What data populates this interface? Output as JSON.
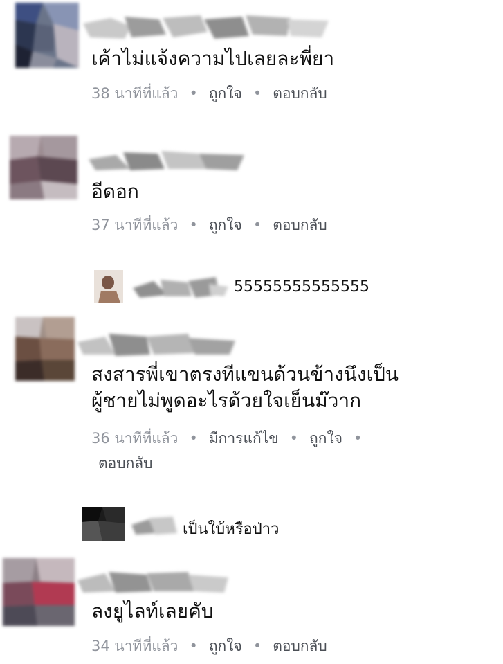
{
  "comments": [
    {
      "text": "เค้าไม่แจ้งความไปเลยละพี่ยา",
      "time": "38 นาทีที่แล้ว",
      "like": "ถูกใจ",
      "reply": "ตอบกลับ"
    },
    {
      "text": "อีดอก",
      "time": "37 นาทีที่แล้ว",
      "like": "ถูกใจ",
      "reply": "ตอบกลับ"
    },
    {
      "text_line1": "สงสารพี่เขาตรงทีแขนด้วนข้างนึงเป็น",
      "text_line2": "ผู้ชายไม่พูดอะไรด้วยใจเย็นม๊วาก",
      "time": "36 นาทีที่แล้ว",
      "edited": "มีการแก้ไข",
      "like": "ถูกใจ",
      "reply": "ตอบกลับ"
    },
    {
      "text": "ลงยูไลท์เลยคับ",
      "time": "34 นาทีที่แล้ว",
      "like": "ถูกใจ",
      "reply": "ตอบกลับ"
    }
  ],
  "replies": [
    {
      "text": "55555555555555"
    },
    {
      "text": "เป็นใบ้หรือป่าว"
    }
  ]
}
